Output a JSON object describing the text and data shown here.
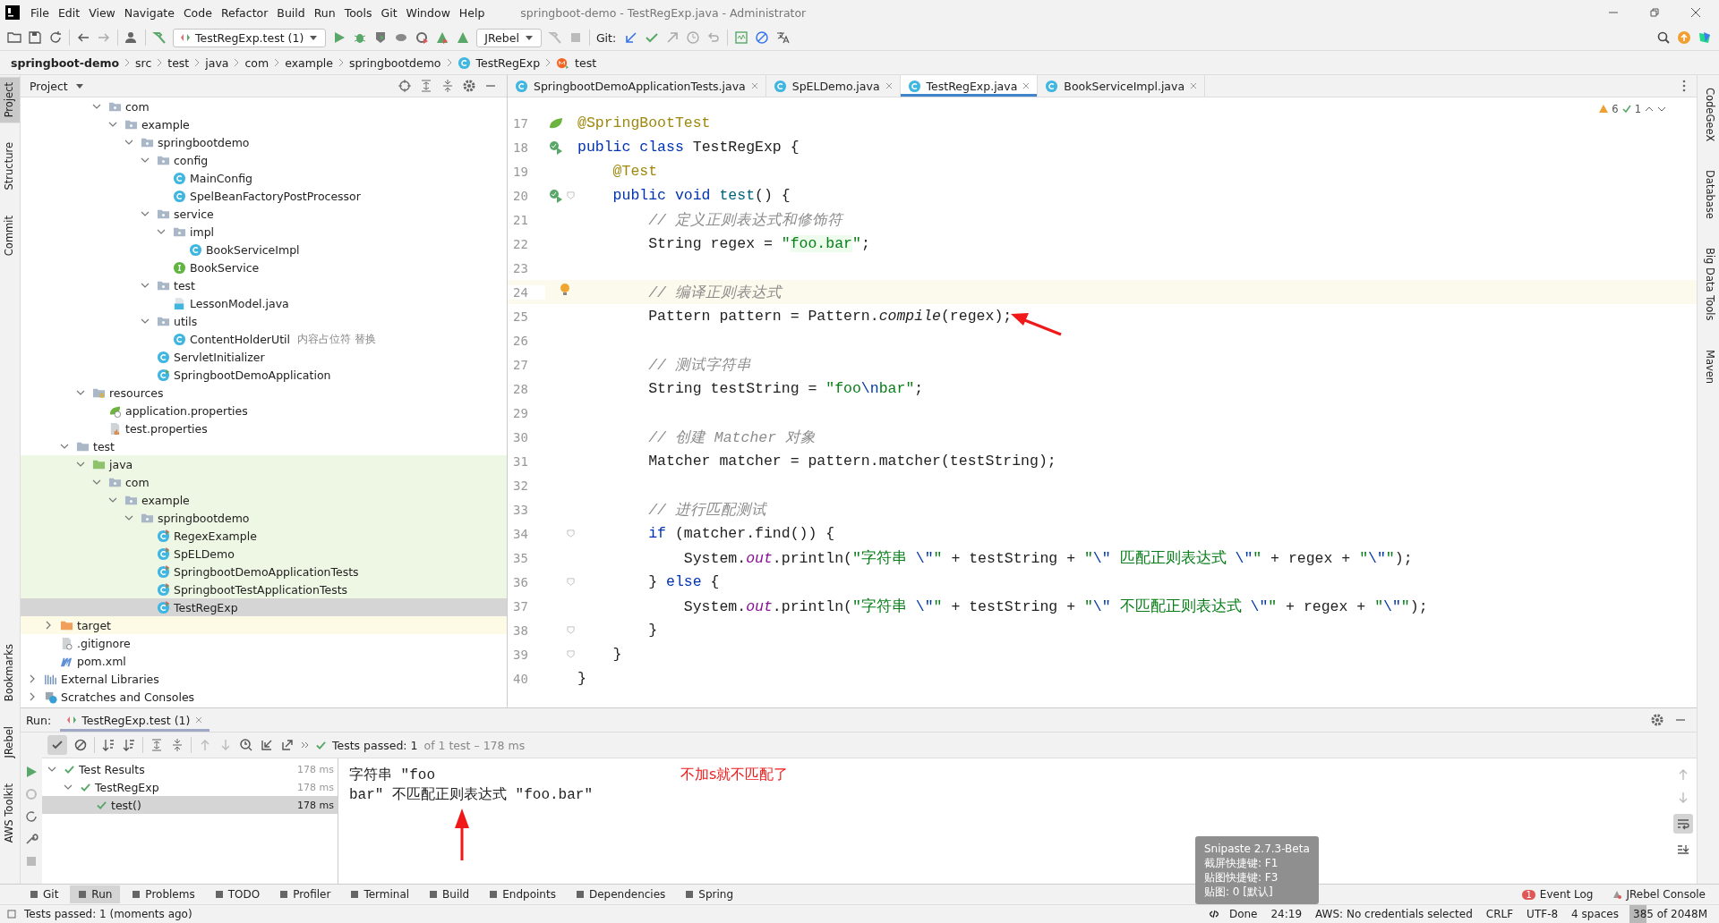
{
  "window": {
    "title": "springboot-demo - TestRegExp.java - Administrator"
  },
  "menu": [
    "File",
    "Edit",
    "View",
    "Navigate",
    "Code",
    "Refactor",
    "Build",
    "Run",
    "Tools",
    "Git",
    "Window",
    "Help"
  ],
  "toolbar": {
    "run_config": "TestRegExp.test (1)",
    "jrebel": "JRebel",
    "git_label": "Git:"
  },
  "breadcrumb": [
    {
      "label": "springboot-demo",
      "kind": "project"
    },
    {
      "label": "src",
      "kind": "folder"
    },
    {
      "label": "test",
      "kind": "folder"
    },
    {
      "label": "java",
      "kind": "folder"
    },
    {
      "label": "com",
      "kind": "folder"
    },
    {
      "label": "example",
      "kind": "folder"
    },
    {
      "label": "springbootdemo",
      "kind": "folder"
    },
    {
      "label": "TestRegExp",
      "kind": "class"
    },
    {
      "label": "test",
      "kind": "method"
    }
  ],
  "left_strip": {
    "top": [
      {
        "label": "Project",
        "selected": true
      },
      {
        "label": "Structure",
        "selected": false
      },
      {
        "label": "Commit",
        "selected": false
      }
    ],
    "bottom": [
      {
        "label": "Bookmarks",
        "selected": false
      },
      {
        "label": "JRebel",
        "selected": false
      },
      {
        "label": "AWS Toolkit",
        "selected": false
      }
    ]
  },
  "right_strip": [
    "CodeGeeX",
    "Database",
    "Big Data Tools",
    "Maven"
  ],
  "project": {
    "title": "Project",
    "tree": [
      {
        "children": [
          {
            "children": [
              {
                "children": [
                  {
                    "children": [
                      {
                        "label": "com",
                        "kind": "package",
                        "expanded": true,
                        "selected": false,
                        "children": [
                          {
                            "label": "example",
                            "kind": "package",
                            "expanded": true,
                            "selected": false,
                            "children": [
                              {
                                "label": "springbootdemo",
                                "kind": "package",
                                "expanded": true,
                                "selected": false,
                                "children": [
                                  {
                                    "label": "config",
                                    "kind": "package",
                                    "expanded": true,
                                    "selected": false,
                                    "children": [
                                      {
                                        "label": "MainConfig",
                                        "kind": "class",
                                        "selected": false
                                      },
                                      {
                                        "label": "SpelBeanFactoryPostProcessor",
                                        "kind": "class",
                                        "selected": false
                                      }
                                    ]
                                  },
                                  {
                                    "label": "service",
                                    "kind": "package",
                                    "expanded": true,
                                    "selected": false,
                                    "children": [
                                      {
                                        "label": "impl",
                                        "kind": "package",
                                        "expanded": true,
                                        "selected": false,
                                        "children": [
                                          {
                                            "label": "BookServiceImpl",
                                            "kind": "class",
                                            "selected": false
                                          }
                                        ]
                                      },
                                      {
                                        "label": "BookService",
                                        "kind": "interface",
                                        "selected": false
                                      }
                                    ]
                                  },
                                  {
                                    "label": "test",
                                    "kind": "package",
                                    "expanded": true,
                                    "selected": false,
                                    "children": [
                                      {
                                        "label": "LessonModel.java",
                                        "kind": "java-file",
                                        "selected": false
                                      }
                                    ]
                                  },
                                  {
                                    "label": "utils",
                                    "kind": "package",
                                    "expanded": true,
                                    "selected": false,
                                    "children": [
                                      {
                                        "label": "ContentHolderUtil",
                                        "kind": "class",
                                        "note": "内容占位符 替换",
                                        "selected": false
                                      }
                                    ]
                                  },
                                  {
                                    "label": "ServletInitializer",
                                    "kind": "class",
                                    "selected": false
                                  },
                                  {
                                    "label": "SpringbootDemoApplication",
                                    "kind": "spring-class",
                                    "selected": false
                                  }
                                ]
                              }
                            ]
                          }
                        ]
                      }
                    ]
                  },
                  {
                    "label": "resources",
                    "kind": "resources",
                    "expanded": true,
                    "selected": false,
                    "children": [
                      {
                        "label": "application.properties",
                        "kind": "spring-props",
                        "selected": false
                      },
                      {
                        "label": "test.properties",
                        "kind": "props",
                        "selected": false
                      }
                    ]
                  }
                ]
              },
              {
                "label": "test",
                "kind": "folder",
                "expanded": true,
                "selected": false,
                "children": [
                  {
                    "label": "java",
                    "kind": "test-root",
                    "expanded": true,
                    "selected": false,
                    "children": [
                      {
                        "label": "com",
                        "kind": "package",
                        "expanded": true,
                        "selected": false,
                        "children": [
                          {
                            "label": "example",
                            "kind": "package",
                            "expanded": true,
                            "selected": false,
                            "children": [
                              {
                                "label": "springbootdemo",
                                "kind": "package",
                                "expanded": true,
                                "selected": false,
                                "children": [
                                  {
                                    "label": "RegexExample",
                                    "kind": "test-class",
                                    "selected": false
                                  },
                                  {
                                    "label": "SpELDemo",
                                    "kind": "test-class",
                                    "selected": false
                                  },
                                  {
                                    "label": "SpringbootDemoApplicationTests",
                                    "kind": "test-class",
                                    "selected": false
                                  },
                                  {
                                    "label": "SpringbootTestApplicationTests",
                                    "kind": "test-class",
                                    "selected": false
                                  },
                                  {
                                    "label": "TestRegExp",
                                    "kind": "test-class",
                                    "selected": true
                                  }
                                ]
                              }
                            ]
                          }
                        ]
                      }
                    ]
                  }
                ]
              }
            ]
          },
          {
            "label": "target",
            "kind": "excluded-folder",
            "expanded": false,
            "selected": false
          },
          {
            "label": ".gitignore",
            "kind": "gitignore",
            "selected": false
          },
          {
            "label": "pom.xml",
            "kind": "maven",
            "selected": false
          }
        ]
      },
      {
        "label": "External Libraries",
        "kind": "libraries",
        "expanded": false,
        "selected": false
      },
      {
        "label": "Scratches and Consoles",
        "kind": "scratches",
        "expanded": false,
        "selected": false
      }
    ]
  },
  "editor": {
    "tabs": [
      {
        "label": "SpringbootDemoApplicationTests.java",
        "selected": false
      },
      {
        "label": "SpELDemo.java",
        "selected": false
      },
      {
        "label": "TestRegExp.java",
        "selected": true
      },
      {
        "label": "BookServiceImpl.java",
        "selected": false
      }
    ],
    "warnings": "6",
    "checks": "1",
    "lines": [
      {
        "number": "17",
        "kind": "spring",
        "fold": false,
        "current": false,
        "tokens": [
          {
            "kind": "ann",
            "text": "@SpringBootTest"
          }
        ]
      },
      {
        "number": "18",
        "kind": "run",
        "fold": false,
        "current": false,
        "tokens": [
          {
            "kind": "kw",
            "text": "public class "
          },
          {
            "kind": "plain",
            "text": "TestRegExp {"
          }
        ]
      },
      {
        "number": "19",
        "fold": false,
        "current": false,
        "tokens": [
          {
            "kind": "ann",
            "text": "    @Test"
          }
        ]
      },
      {
        "number": "20",
        "kind": "run",
        "fold": true,
        "current": false,
        "tokens": [
          {
            "kind": "kw",
            "text": "    public void "
          },
          {
            "kind": "fn",
            "text": "test"
          },
          {
            "kind": "plain",
            "text": "() {"
          }
        ]
      },
      {
        "number": "21",
        "fold": false,
        "current": false,
        "tokens": [
          {
            "kind": "cmt",
            "text": "        // 定义正则表达式和修饰符"
          }
        ]
      },
      {
        "number": "22",
        "fold": false,
        "current": false,
        "tokens": [
          {
            "kind": "plain",
            "text": "        String regex = "
          },
          {
            "kind": "str",
            "text": "\""
          },
          {
            "kind": "regex",
            "text": "foo.bar"
          },
          {
            "kind": "str",
            "text": "\""
          },
          {
            "kind": "plain",
            "text": ";"
          }
        ]
      },
      {
        "number": "23",
        "fold": false,
        "current": false
      },
      {
        "number": "24",
        "kind": "bulb",
        "fold": false,
        "current": true,
        "tokens": [
          {
            "kind": "cmt",
            "text": "        // 编译正则表达式"
          }
        ]
      },
      {
        "number": "25",
        "fold": false,
        "current": false,
        "tokens": [
          {
            "kind": "plain",
            "text": "        Pattern pattern = Pattern."
          },
          {
            "kind": "italic",
            "text": "compile"
          },
          {
            "kind": "plain",
            "text": "(regex);"
          }
        ]
      },
      {
        "number": "26",
        "fold": false,
        "current": false
      },
      {
        "number": "27",
        "fold": false,
        "current": false,
        "tokens": [
          {
            "kind": "cmt",
            "text": "        // 测试字符串"
          }
        ]
      },
      {
        "number": "28",
        "fold": false,
        "current": false,
        "tokens": [
          {
            "kind": "plain",
            "text": "        String testString = "
          },
          {
            "kind": "str",
            "text": "\"foo"
          },
          {
            "kind": "esc",
            "text": "\\n"
          },
          {
            "kind": "str",
            "text": "bar\""
          },
          {
            "kind": "plain",
            "text": ";"
          }
        ]
      },
      {
        "number": "29",
        "fold": false,
        "current": false
      },
      {
        "number": "30",
        "fold": false,
        "current": false,
        "tokens": [
          {
            "kind": "cmt",
            "text": "        // 创建 Matcher 对象"
          }
        ]
      },
      {
        "number": "31",
        "fold": false,
        "current": false,
        "tokens": [
          {
            "kind": "plain",
            "text": "        Matcher matcher = pattern.matcher(testString);"
          }
        ]
      },
      {
        "number": "32",
        "fold": false,
        "current": false
      },
      {
        "number": "33",
        "fold": false,
        "current": false,
        "tokens": [
          {
            "kind": "cmt",
            "text": "        // 进行匹配测试"
          }
        ]
      },
      {
        "number": "34",
        "fold": true,
        "current": false,
        "tokens": [
          {
            "kind": "kw",
            "text": "        if"
          },
          {
            "kind": "plain",
            "text": " (matcher.find()) {"
          }
        ]
      },
      {
        "number": "35",
        "fold": false,
        "current": false,
        "tokens": [
          {
            "kind": "plain",
            "text": "            System."
          },
          {
            "kind": "static",
            "text": "out"
          },
          {
            "kind": "plain",
            "text": ".println("
          },
          {
            "kind": "str",
            "text": "\"字符串 "
          },
          {
            "kind": "esc",
            "text": "\\\""
          },
          {
            "kind": "str",
            "text": "\""
          },
          {
            "kind": "plain",
            "text": " + testString + "
          },
          {
            "kind": "str",
            "text": "\""
          },
          {
            "kind": "esc",
            "text": "\\\""
          },
          {
            "kind": "str",
            "text": " 匹配正则表达式 "
          },
          {
            "kind": "esc",
            "text": "\\\""
          },
          {
            "kind": "str",
            "text": "\""
          },
          {
            "kind": "plain",
            "text": " + regex + "
          },
          {
            "kind": "str",
            "text": "\""
          },
          {
            "kind": "esc",
            "text": "\\\""
          },
          {
            "kind": "str",
            "text": "\""
          },
          {
            "kind": "plain",
            "text": ");"
          }
        ]
      },
      {
        "number": "36",
        "fold": true,
        "current": false,
        "tokens": [
          {
            "kind": "plain",
            "text": "        } "
          },
          {
            "kind": "kw",
            "text": "else"
          },
          {
            "kind": "plain",
            "text": " {"
          }
        ]
      },
      {
        "number": "37",
        "fold": false,
        "current": false,
        "tokens": [
          {
            "kind": "plain",
            "text": "            System."
          },
          {
            "kind": "static",
            "text": "out"
          },
          {
            "kind": "plain",
            "text": ".println("
          },
          {
            "kind": "str",
            "text": "\"字符串 "
          },
          {
            "kind": "esc",
            "text": "\\\""
          },
          {
            "kind": "str",
            "text": "\""
          },
          {
            "kind": "plain",
            "text": " + testString + "
          },
          {
            "kind": "str",
            "text": "\""
          },
          {
            "kind": "esc",
            "text": "\\\""
          },
          {
            "kind": "str",
            "text": " 不匹配正则表达式 "
          },
          {
            "kind": "esc",
            "text": "\\\""
          },
          {
            "kind": "str",
            "text": "\""
          },
          {
            "kind": "plain",
            "text": " + regex + "
          },
          {
            "kind": "str",
            "text": "\""
          },
          {
            "kind": "esc",
            "text": "\\\""
          },
          {
            "kind": "str",
            "text": "\""
          },
          {
            "kind": "plain",
            "text": ");"
          }
        ]
      },
      {
        "number": "38",
        "fold": true,
        "current": false,
        "tokens": [
          {
            "kind": "plain",
            "text": "        }"
          }
        ]
      },
      {
        "number": "39",
        "fold": true,
        "current": false,
        "tokens": [
          {
            "kind": "plain",
            "text": "    }"
          }
        ]
      },
      {
        "number": "40",
        "fold": false,
        "current": false,
        "tokens": [
          {
            "kind": "plain",
            "text": "}"
          }
        ]
      }
    ]
  },
  "run": {
    "label": "Run:",
    "tab": "TestRegExp.test (1)",
    "status": "Tests passed: 1",
    "status_detail": "of 1 test – 178 ms",
    "tests": [
      {
        "label": "Test Results",
        "time": "178 ms",
        "expanded": true,
        "selected": false,
        "children": [
          {
            "label": "TestRegExp",
            "time": "178 ms",
            "expanded": true,
            "selected": false,
            "children": [
              {
                "label": "test()",
                "time": "178 ms",
                "selected": true
              }
            ]
          }
        ]
      }
    ],
    "console": [
      "字符串 \"foo",
      "bar\" 不匹配正则表达式 \"foo.bar\""
    ],
    "annotation": "不加s就不匹配了"
  },
  "tooltip": [
    "Snipaste 2.7.3-Beta",
    "截屏快捷键: F1",
    "贴图快捷键: F3",
    "贴图: 0 [默认]"
  ],
  "tool_windows": [
    {
      "label": "Git",
      "selected": false
    },
    {
      "label": "Run",
      "selected": true
    },
    {
      "label": "Problems",
      "selected": false
    },
    {
      "label": "TODO",
      "selected": false
    },
    {
      "label": "Profiler",
      "selected": false
    },
    {
      "label": "Terminal",
      "selected": false
    },
    {
      "label": "Build",
      "selected": false
    },
    {
      "label": "Endpoints",
      "selected": false
    },
    {
      "label": "Dependencies",
      "selected": false
    },
    {
      "label": "Spring",
      "selected": false
    }
  ],
  "tool_windows_right": [
    {
      "label": "Event Log",
      "badge": "1"
    },
    {
      "label": "JRebel Console"
    }
  ],
  "status_bar": {
    "message": "Tests passed: 1 (moments ago)",
    "items": [
      "Done",
      "24:19",
      "AWS: No credentials selected",
      "CRLF",
      "UTF-8",
      "4 spaces"
    ],
    "memory": {
      "text": "385 of 2048M",
      "level": 0.19
    }
  }
}
